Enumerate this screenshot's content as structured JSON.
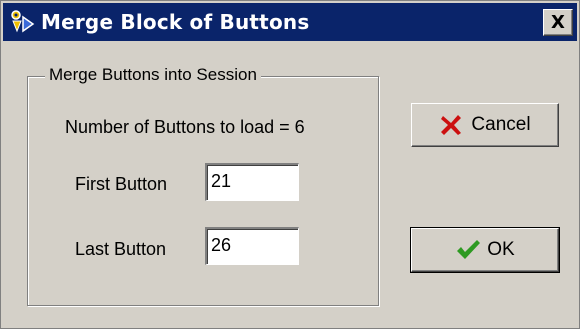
{
  "window": {
    "title": "Merge Block of Buttons",
    "close_label": "X"
  },
  "group": {
    "legend": "Merge Buttons into Session",
    "count_text": "Number of Buttons to load = 6",
    "first_label": "First Button",
    "first_value": "21",
    "last_label": "Last Button",
    "last_value": "26"
  },
  "buttons": {
    "cancel_label": "Cancel",
    "ok_label": "OK"
  },
  "icons": {
    "app": "app-icon",
    "cancel": "red-x-icon",
    "ok": "green-check-icon"
  },
  "colors": {
    "title_bar": "#0a246a",
    "dialog_bg": "#d4d0c8",
    "cancel_icon": "#cc1010",
    "ok_icon": "#2e9a22"
  }
}
